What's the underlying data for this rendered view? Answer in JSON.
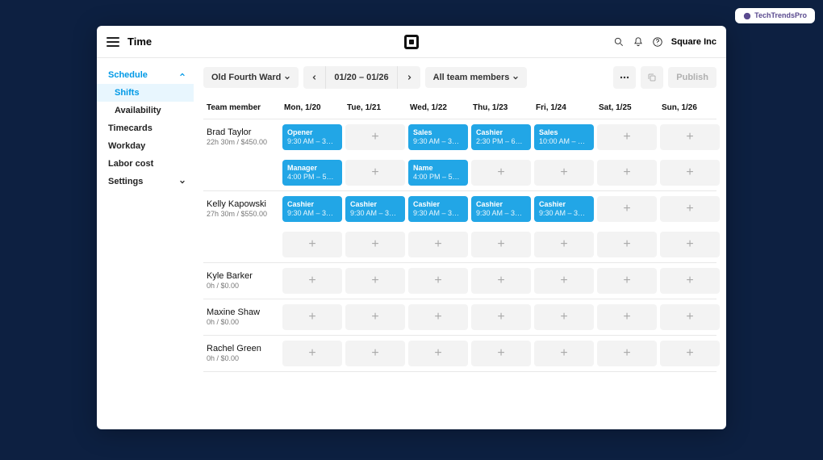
{
  "watermark": "TechTrendsPro",
  "header": {
    "title": "Time",
    "account": "Square Inc"
  },
  "sidebar": {
    "items": [
      {
        "label": "Schedule",
        "expanded": true,
        "children": [
          "Shifts",
          "Availability"
        ],
        "active_child": 0
      },
      {
        "label": "Timecards"
      },
      {
        "label": "Workday"
      },
      {
        "label": "Labor cost"
      },
      {
        "label": "Settings",
        "expanded": false
      }
    ]
  },
  "controls": {
    "location": "Old Fourth Ward",
    "date_range": "01/20 – 01/26",
    "team_filter": "All team members",
    "publish": "Publish"
  },
  "colors": {
    "shift_bg": "#22a6e6",
    "shift_fg": "#ffffff"
  },
  "grid": {
    "columns": [
      "Team member",
      "Mon, 1/20",
      "Tue, 1/21",
      "Wed, 1/22",
      "Thu, 1/23",
      "Fri, 1/24",
      "Sat, 1/25",
      "Sun, 1/26"
    ],
    "members": [
      {
        "name": "Brad Taylor",
        "meta": "22h 30m / $450.00",
        "rows": 2,
        "days": [
          [
            {
              "role": "Opener",
              "time": "9:30 AM – 3…"
            },
            null,
            {
              "role": "Sales",
              "time": "9:30 AM – 3…"
            },
            {
              "role": "Cashier",
              "time": "2:30 PM – 6…"
            },
            {
              "role": "Sales",
              "time": "10:00 AM – …"
            },
            null,
            null
          ],
          [
            {
              "role": "Manager",
              "time": "4:00 PM – 5…"
            },
            null,
            {
              "role": "Name",
              "time": "4:00 PM – 5…"
            },
            null,
            null,
            null,
            null
          ]
        ]
      },
      {
        "name": "Kelly Kapowski",
        "meta": "27h 30m / $550.00",
        "rows": 2,
        "days": [
          [
            {
              "role": "Cashier",
              "time": "9:30 AM – 3…"
            },
            {
              "role": "Cashier",
              "time": "9:30 AM – 3…"
            },
            {
              "role": "Cashier",
              "time": "9:30 AM – 3…"
            },
            {
              "role": "Cashier",
              "time": "9:30 AM – 3…"
            },
            {
              "role": "Cashier",
              "time": "9:30 AM – 3…"
            },
            null,
            null
          ],
          [
            null,
            null,
            null,
            null,
            null,
            null,
            null
          ]
        ]
      },
      {
        "name": "Kyle Barker",
        "meta": "0h / $0.00",
        "rows": 1,
        "days": [
          [
            null,
            null,
            null,
            null,
            null,
            null,
            null
          ]
        ]
      },
      {
        "name": "Maxine Shaw",
        "meta": "0h / $0.00",
        "rows": 1,
        "days": [
          [
            null,
            null,
            null,
            null,
            null,
            null,
            null
          ]
        ]
      },
      {
        "name": "Rachel Green",
        "meta": "0h / $0.00",
        "rows": 1,
        "days": [
          [
            null,
            null,
            null,
            null,
            null,
            null,
            null
          ]
        ]
      }
    ]
  }
}
